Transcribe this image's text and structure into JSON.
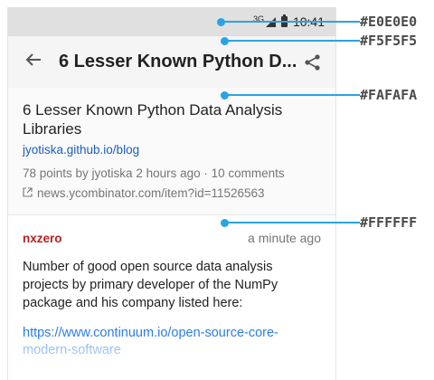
{
  "status_bar": {
    "network": "3G",
    "time": "10:41"
  },
  "app_bar": {
    "back_icon": "arrow-left",
    "title": "6 Lesser Known Python D...",
    "share_icon": "share"
  },
  "story": {
    "title": "6 Lesser Known Python Data Analysis Libraries",
    "domain": "jyotiska.github.io/blog",
    "meta": "78 points by jyotiska 2 hours ago · 10 comments",
    "hn_link": "news.ycombinator.com/item?id=11526563"
  },
  "comment": {
    "author": "nxzero",
    "time": "a minute ago",
    "text": "Number of good open source data analysis projects by primary developer of the NumPy package and his company listed here:",
    "link_part1": "https://www.continuum.io/open-source-core-",
    "link_part2": "modern-software"
  },
  "annotations": [
    {
      "label": "#E0E0E0",
      "color": "#E0E0E0"
    },
    {
      "label": "#F5F5F5",
      "color": "#F5F5F5"
    },
    {
      "label": "#FAFAFA",
      "color": "#FAFAFA"
    },
    {
      "label": "#FFFFFF",
      "color": "#FFFFFF"
    }
  ],
  "accent_color": "#2AA3E6"
}
